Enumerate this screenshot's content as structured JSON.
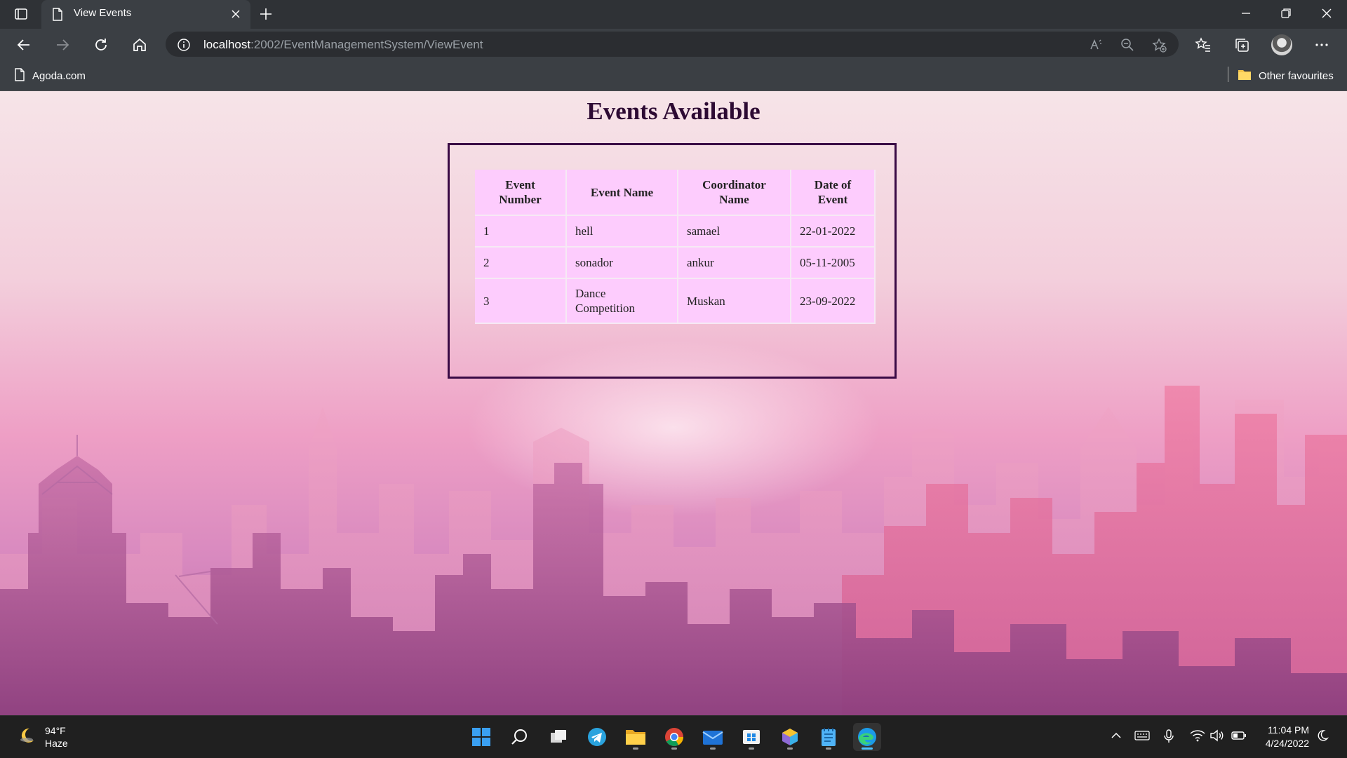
{
  "browser": {
    "tab": {
      "title": "View Events"
    },
    "address": {
      "host": "localhost",
      "path": ":2002/EventManagementSystem/ViewEvent"
    },
    "bookmarks": {
      "left": "Agoda.com",
      "right": "Other favourites"
    }
  },
  "page": {
    "title": "Events Available",
    "table": {
      "headers": [
        [
          "Event",
          "Number"
        ],
        [
          "Event Name"
        ],
        [
          "Coordinator",
          "Name"
        ],
        [
          "Date of",
          "Event"
        ]
      ],
      "rows": [
        {
          "number": "1",
          "name": [
            "hell"
          ],
          "coordinator": "samael",
          "date": "22-01-2022"
        },
        {
          "number": "2",
          "name": [
            "sonador"
          ],
          "coordinator": "ankur",
          "date": "05-11-2005"
        },
        {
          "number": "3",
          "name": [
            "Dance",
            "Competition"
          ],
          "coordinator": "Muskan",
          "date": "23-09-2022"
        }
      ]
    }
  },
  "taskbar": {
    "weather": {
      "temp": "94°F",
      "condition": "Haze"
    },
    "clock": {
      "time": "11:04 PM",
      "date": "4/24/2022"
    }
  },
  "colors": {
    "page_title": "#2d0a33",
    "table_cell": "#fdccfd",
    "box_border": "#3a0a45",
    "accent": "#4cc2ff"
  }
}
